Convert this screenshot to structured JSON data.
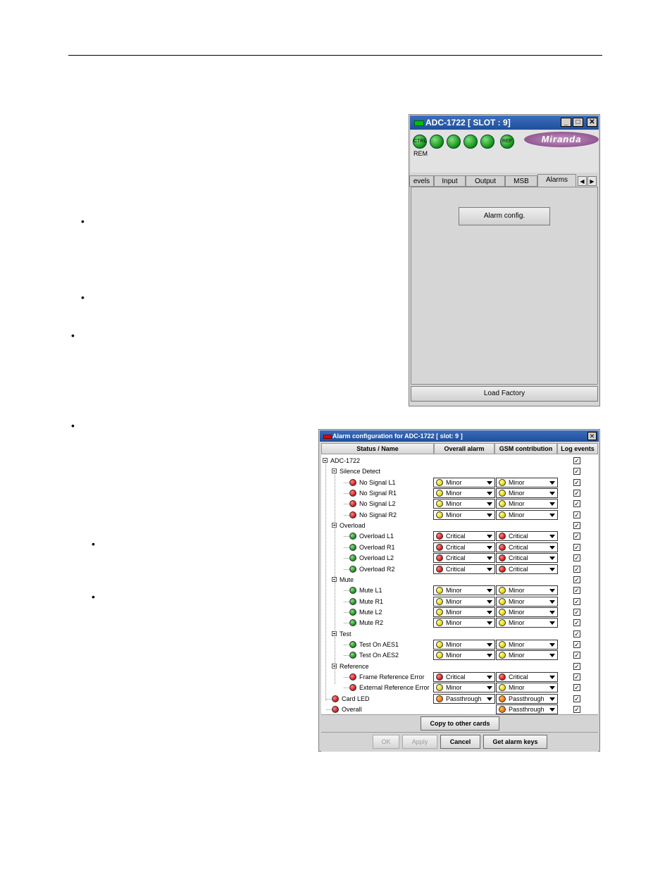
{
  "panel": {
    "title": "ADC-1722 [ SLOT : 9]",
    "ctrl_icon": "CTRL",
    "ref_icon": "REF",
    "rem_label": "REM",
    "logo_text": "Miranda",
    "tabs": [
      "evels",
      "Input",
      "Output",
      "MSB",
      "Alarms"
    ],
    "active_tab": "Alarms",
    "alarm_config_button": "Alarm config.",
    "load_factory_button": "Load Factory",
    "minimize": "_",
    "maximize": "□",
    "close": "✕"
  },
  "dialog": {
    "title": "Alarm configuration for ADC-1722 [ slot: 9 ]",
    "close": "✕",
    "columns": [
      "Status / Name",
      "Overall alarm",
      "GSM contribution",
      "Log events"
    ],
    "rows": [
      {
        "label": "ADC-1722",
        "level": 0,
        "expander": true
      },
      {
        "label": "Silence Detect",
        "level": 1,
        "expander": true
      },
      {
        "label": "No Signal L1",
        "level": 2,
        "status": "red",
        "overall": "Minor",
        "overall_color": "yellow",
        "gsm": "Minor",
        "gsm_color": "yellow"
      },
      {
        "label": "No Signal R1",
        "level": 2,
        "status": "red",
        "overall": "Minor",
        "overall_color": "yellow",
        "gsm": "Minor",
        "gsm_color": "yellow"
      },
      {
        "label": "No Signal L2",
        "level": 2,
        "status": "red",
        "overall": "Minor",
        "overall_color": "yellow",
        "gsm": "Minor",
        "gsm_color": "yellow"
      },
      {
        "label": "No Signal R2",
        "level": 2,
        "status": "red",
        "overall": "Minor",
        "overall_color": "yellow",
        "gsm": "Minor",
        "gsm_color": "yellow"
      },
      {
        "label": "Overload",
        "level": 1,
        "expander": true
      },
      {
        "label": "Overload L1",
        "level": 2,
        "status": "green",
        "overall": "Critical",
        "overall_color": "red",
        "gsm": "Critical",
        "gsm_color": "red"
      },
      {
        "label": "Overload R1",
        "level": 2,
        "status": "green",
        "overall": "Critical",
        "overall_color": "red",
        "gsm": "Critical",
        "gsm_color": "red"
      },
      {
        "label": "Overload L2",
        "level": 2,
        "status": "green",
        "overall": "Critical",
        "overall_color": "red",
        "gsm": "Critical",
        "gsm_color": "red"
      },
      {
        "label": "Overload R2",
        "level": 2,
        "status": "green",
        "overall": "Critical",
        "overall_color": "red",
        "gsm": "Critical",
        "gsm_color": "red"
      },
      {
        "label": "Mute",
        "level": 1,
        "expander": true
      },
      {
        "label": "Mute L1",
        "level": 2,
        "status": "green",
        "overall": "Minor",
        "overall_color": "yellow",
        "gsm": "Minor",
        "gsm_color": "yellow"
      },
      {
        "label": "Mute R1",
        "level": 2,
        "status": "green",
        "overall": "Minor",
        "overall_color": "yellow",
        "gsm": "Minor",
        "gsm_color": "yellow"
      },
      {
        "label": "Mute L2",
        "level": 2,
        "status": "green",
        "overall": "Minor",
        "overall_color": "yellow",
        "gsm": "Minor",
        "gsm_color": "yellow"
      },
      {
        "label": "Mute R2",
        "level": 2,
        "status": "green",
        "overall": "Minor",
        "overall_color": "yellow",
        "gsm": "Minor",
        "gsm_color": "yellow"
      },
      {
        "label": "Test",
        "level": 1,
        "expander": true
      },
      {
        "label": "Test On AES1",
        "level": 2,
        "status": "green",
        "overall": "Minor",
        "overall_color": "yellow",
        "gsm": "Minor",
        "gsm_color": "yellow"
      },
      {
        "label": "Test On AES2",
        "level": 2,
        "status": "green",
        "overall": "Minor",
        "overall_color": "yellow",
        "gsm": "Minor",
        "gsm_color": "yellow"
      },
      {
        "label": "Reference",
        "level": 1,
        "expander": true
      },
      {
        "label": "Frame Reference Error",
        "level": 2,
        "status": "red",
        "overall": "Critical",
        "overall_color": "red",
        "gsm": "Critical",
        "gsm_color": "red"
      },
      {
        "label": "External Reference Error",
        "level": 2,
        "status": "red",
        "overall": "Minor",
        "overall_color": "yellow",
        "gsm": "Minor",
        "gsm_color": "yellow"
      },
      {
        "label": "Card LED",
        "level": 1,
        "status": "red",
        "overall": "Passthrough",
        "overall_color": "orange",
        "gsm": "Passthrough",
        "gsm_color": "orange"
      },
      {
        "label": "Overall",
        "level": 1,
        "status": "red",
        "gsm": "Passthrough",
        "gsm_color": "orange"
      }
    ],
    "checkmark": "✓",
    "copy_button": "Copy to other cards",
    "ok_button": "OK",
    "apply_button": "Apply",
    "cancel_button": "Cancel",
    "get_keys_button": "Get alarm keys"
  },
  "bullet_glyph": "•"
}
